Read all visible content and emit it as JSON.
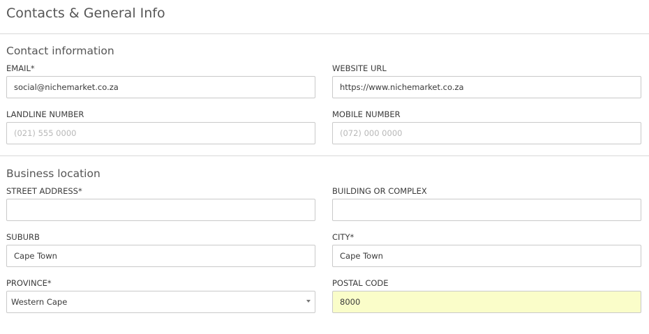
{
  "header": {
    "title": "Contacts & General Info"
  },
  "contact": {
    "section_title": "Contact information",
    "email": {
      "label": "EMAIL*",
      "value": "social@nichemarket.co.za"
    },
    "website": {
      "label": "WEBSITE URL",
      "value": "https://www.nichemarket.co.za"
    },
    "landline": {
      "label": "LANDLINE NUMBER",
      "placeholder": "(021) 555 0000",
      "value": ""
    },
    "mobile": {
      "label": "MOBILE NUMBER",
      "placeholder": "(072) 000 0000",
      "value": ""
    }
  },
  "location": {
    "section_title": "Business location",
    "street": {
      "label": "STREET ADDRESS*",
      "value": ""
    },
    "building": {
      "label": "BUILDING OR COMPLEX",
      "value": ""
    },
    "suburb": {
      "label": "SUBURB",
      "value": "Cape Town"
    },
    "city": {
      "label": "CITY*",
      "value": "Cape Town"
    },
    "province": {
      "label": "PROVINCE*",
      "value": "Western Cape"
    },
    "postal": {
      "label": "POSTAL CODE",
      "value": "8000"
    }
  },
  "colors": {
    "autofill_background": "#fafdc9",
    "border": "#c9c9c9",
    "divider": "#d8d8d8"
  }
}
